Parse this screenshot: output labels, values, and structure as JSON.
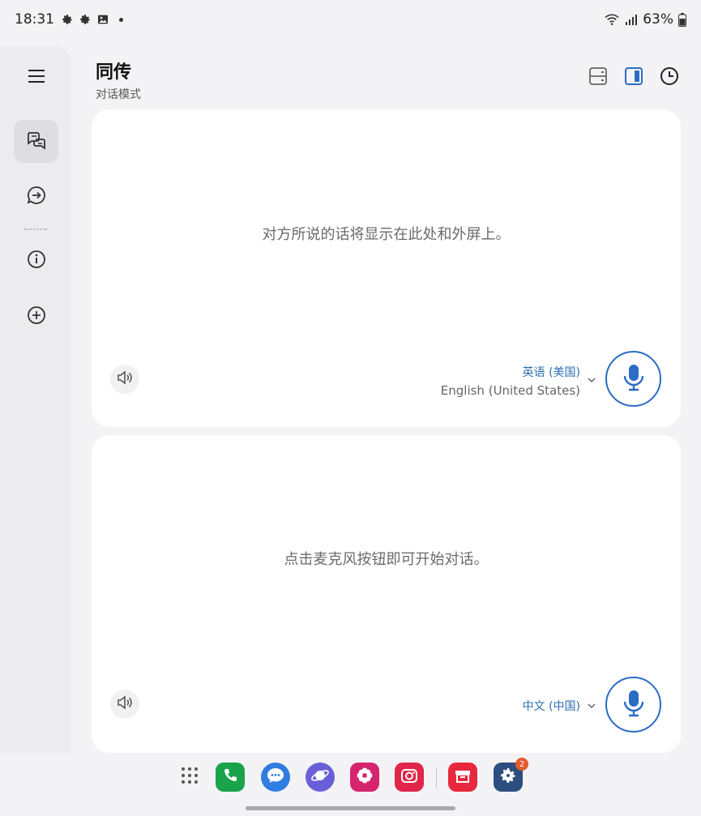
{
  "status_bar": {
    "time": "18:31",
    "battery": "63%",
    "icons": [
      "gear-icon",
      "gear-icon",
      "gallery-icon",
      "wifi-icon",
      "signal-icon",
      "battery-icon"
    ]
  },
  "rail": {
    "items": [
      {
        "name": "menu",
        "icon": "hamburger-menu-icon"
      },
      {
        "name": "conversation",
        "icon": "conversation-mode-icon",
        "active": true
      },
      {
        "name": "listen",
        "icon": "chat-arrow-icon"
      },
      {
        "name": "info",
        "icon": "info-icon"
      },
      {
        "name": "add",
        "icon": "add-circle-icon"
      }
    ]
  },
  "header": {
    "title": "同传",
    "subtitle": "对话模式",
    "icons": [
      "split-view-icon",
      "side-panel-icon",
      "history-clock-icon"
    ]
  },
  "top_panel": {
    "placeholder": "对方所说的话将显示在此处和外屏上。",
    "language_main": "英语 (美国)",
    "language_sub": "English (United States)"
  },
  "bottom_panel": {
    "placeholder": "点击麦克风按钮即可开始对话。",
    "language_main": "中文 (中国)"
  },
  "dock": {
    "apps": [
      "apps-grid-icon",
      "phone-icon",
      "messages-icon",
      "internet-icon",
      "gallery-flower-icon",
      "camera-icon",
      "store-icon",
      "settings-icon"
    ],
    "settings_badge": "2"
  },
  "colors": {
    "accent": "#2b6cc4",
    "language_text": "#2d6fb0",
    "panel": "#ffffff",
    "background": "#f3f3f5"
  }
}
